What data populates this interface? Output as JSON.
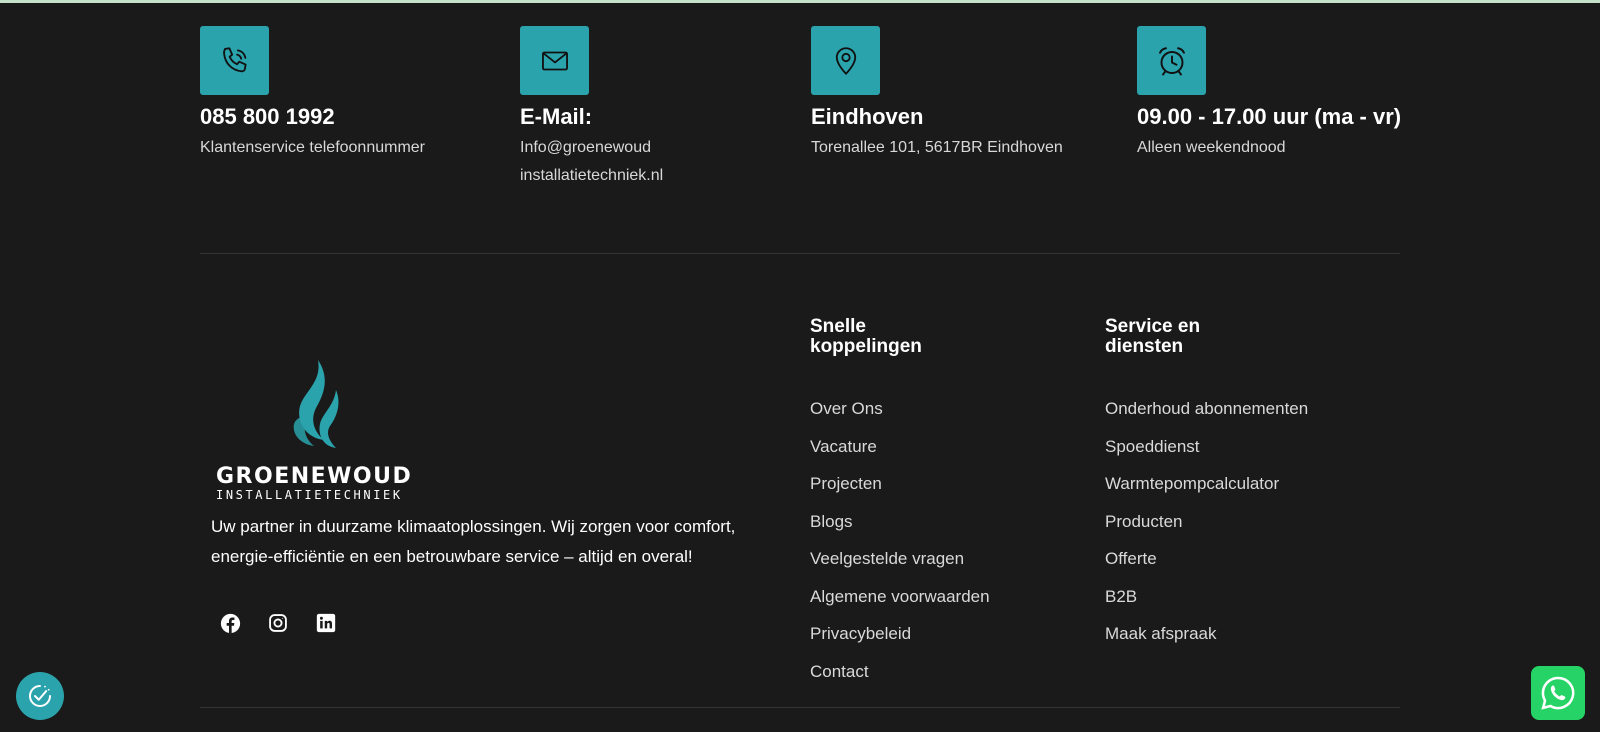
{
  "colors": {
    "background": "#1a1a1a",
    "accent": "#2ba3ad",
    "whatsapp": "#25d366",
    "top_strip": "#c5e3c8"
  },
  "contact": [
    {
      "icon": "phone-icon",
      "title": "085 800 1992",
      "subtitle": "Klantenservice telefoonnummer"
    },
    {
      "icon": "mail-icon",
      "title": "E-Mail:",
      "subtitle": "Info@groenewoud installatietechniek.nl"
    },
    {
      "icon": "location-pin-icon",
      "title": "Eindhoven",
      "subtitle": "Torenallee 101, 5617BR Eindhoven"
    },
    {
      "icon": "alarm-clock-icon",
      "title": "09.00 - 17.00 uur (ma - vr)",
      "subtitle": "Alleen weekendnood"
    }
  ],
  "brand": {
    "name": "GROENEWOUD",
    "subname": "INSTALLATIETECHNIEK",
    "tagline": "Uw partner in duurzame klimaatoplossingen. Wij zorgen voor comfort, energie-efficiëntie en een betrouwbare service – altijd en overal!"
  },
  "socials": [
    "facebook-icon",
    "instagram-icon",
    "linkedin-icon"
  ],
  "quick_links": {
    "heading_line1": "Snelle",
    "heading_line2": "koppelingen",
    "items": [
      "Over Ons",
      "Vacature",
      "Projecten",
      "Blogs",
      "Veelgestelde vragen",
      "Algemene voorwaarden",
      "Privacybeleid",
      "Contact"
    ]
  },
  "services": {
    "heading_line1": "Service en",
    "heading_line2": "diensten",
    "items": [
      "Onderhoud abonnementen",
      "Spoeddienst",
      "Warmtepompcalculator",
      "Producten",
      "Offerte",
      "B2B",
      "Maak afspraak"
    ]
  }
}
